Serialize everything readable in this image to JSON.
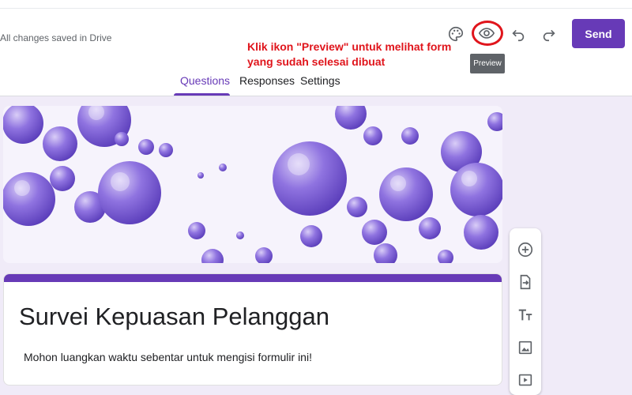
{
  "header": {
    "saved_status": "All changes saved in Drive",
    "send_label": "Send",
    "preview_tooltip": "Preview",
    "icons": [
      "palette-icon",
      "eye-icon",
      "undo-icon",
      "redo-icon"
    ]
  },
  "annotation": {
    "line1": "Klik ikon \"Preview\" untuk melihat form",
    "line2": "yang sudah selesai dibuat",
    "color": "#e0151c"
  },
  "tabs": [
    {
      "label": "Questions",
      "active": true
    },
    {
      "label": "Responses",
      "active": false
    },
    {
      "label": "Settings",
      "active": false
    }
  ],
  "form": {
    "title": "Survei Kepuasan Pelanggan",
    "description": "Mohon luangkan waktu sebentar untuk mengisi formulir ini!"
  },
  "sidebar_tools": [
    "add-question-icon",
    "import-questions-icon",
    "add-title-icon",
    "add-image-icon",
    "add-video-icon"
  ],
  "colors": {
    "accent": "#673ab7",
    "background": "#f0ebf8"
  }
}
